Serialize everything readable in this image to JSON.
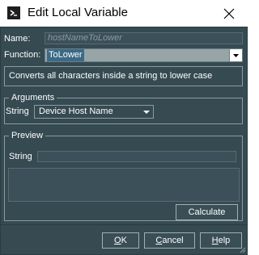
{
  "window": {
    "title": "Edit Local Variable",
    "icon": "script-terminal-icon",
    "close_icon": "close-icon"
  },
  "form": {
    "name_label": "Name:",
    "name_placeholder": "hostNameToLower",
    "function_label": "Function:",
    "function_value": "ToLower",
    "description": "Converts all characters inside a string to lower case"
  },
  "arguments": {
    "group_title": "Arguments",
    "string_label": "String",
    "string_value": "Device Host Name"
  },
  "preview": {
    "group_title": "Preview",
    "string_label": "String",
    "string_value": "",
    "output_value": "",
    "calculate_label": "Calculate"
  },
  "footer": {
    "ok_label": "OK",
    "ok_mnemonic": "O",
    "ok_rest": "K",
    "cancel_mnemonic": "C",
    "cancel_rest": "ancel",
    "help_mnemonic": "H",
    "help_rest": "elp"
  },
  "colors": {
    "background": "#364a52",
    "selection": "#3b6a86",
    "border": "#8a9ca2"
  }
}
